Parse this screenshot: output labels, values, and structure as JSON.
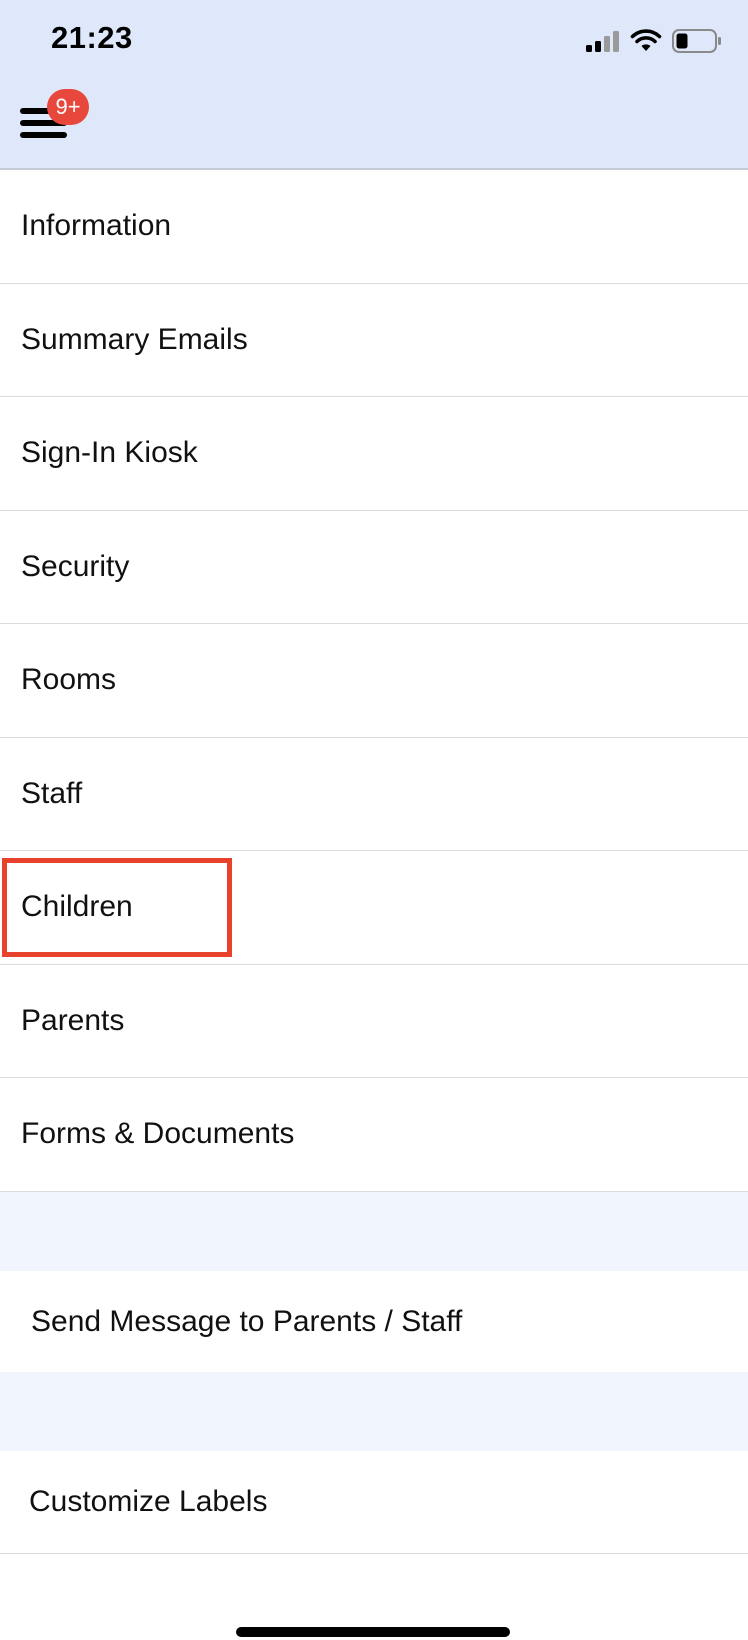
{
  "status_bar": {
    "time": "21:23",
    "icons": [
      "signal-icon",
      "wifi-icon",
      "battery-icon"
    ]
  },
  "header": {
    "menu_icon": "hamburger-menu-icon",
    "badge": "9+",
    "badge_color": "#e8473b",
    "background": "#dfe8fb"
  },
  "menu": {
    "items": [
      {
        "label": "Information"
      },
      {
        "label": "Summary Emails"
      },
      {
        "label": "Sign-In Kiosk"
      },
      {
        "label": "Security"
      },
      {
        "label": "Rooms"
      },
      {
        "label": "Staff"
      },
      {
        "label": "Children",
        "highlighted": true
      },
      {
        "label": "Parents"
      },
      {
        "label": "Forms & Documents"
      }
    ]
  },
  "actions": {
    "send_message": "Send Message to Parents / Staff",
    "customize_labels": "Customize Labels"
  },
  "colors": {
    "highlight": "#e8412c",
    "spacer": "#f1f5fe"
  }
}
